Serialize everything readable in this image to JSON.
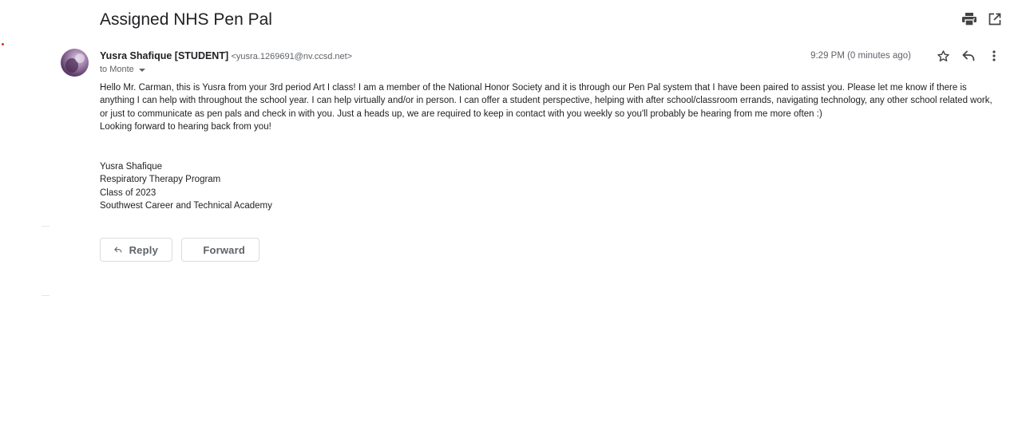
{
  "subject": "Assigned NHS Pen Pal",
  "toolbar": {
    "print_icon": "print-icon",
    "new_window_icon": "open-in-new-window-icon"
  },
  "message": {
    "sender_name": "Yusra Shafique [STUDENT]",
    "sender_email": "<yusra.1269691@nv.ccsd.net>",
    "to_text": "to Monte",
    "timestamp": "9:29 PM (0 minutes ago)",
    "icons": [
      "star-icon",
      "reply-icon",
      "more-options-icon"
    ],
    "body_paragraph": "Hello Mr. Carman, this is Yusra from your 3rd period Art I class! I am a member of the National Honor Society and it is through our Pen Pal system that I have been paired to assist you. Please let me know if there is anything I can help with throughout the school year. I can help virtually and/or in person. I can offer a student perspective, helping with after school/classroom errands, navigating technology, any other school related work, or just to communicate as pen pals and check in with you. Just a heads up, we are required to keep in contact with you weekly so you'll probably be hearing from me more often :)",
    "body_closing": "Looking forward to hearing back from you!",
    "signature": [
      "Yusra Shafique",
      "Respiratory Therapy Program",
      "Class of 2023",
      "Southwest Career and Technical Academy"
    ]
  },
  "actions": {
    "reply_label": "Reply",
    "forward_label": "Forward"
  },
  "colors": {
    "text": "#222222",
    "muted": "#5f6368",
    "border": "#dadce0",
    "unread_dot": "#d93025"
  }
}
